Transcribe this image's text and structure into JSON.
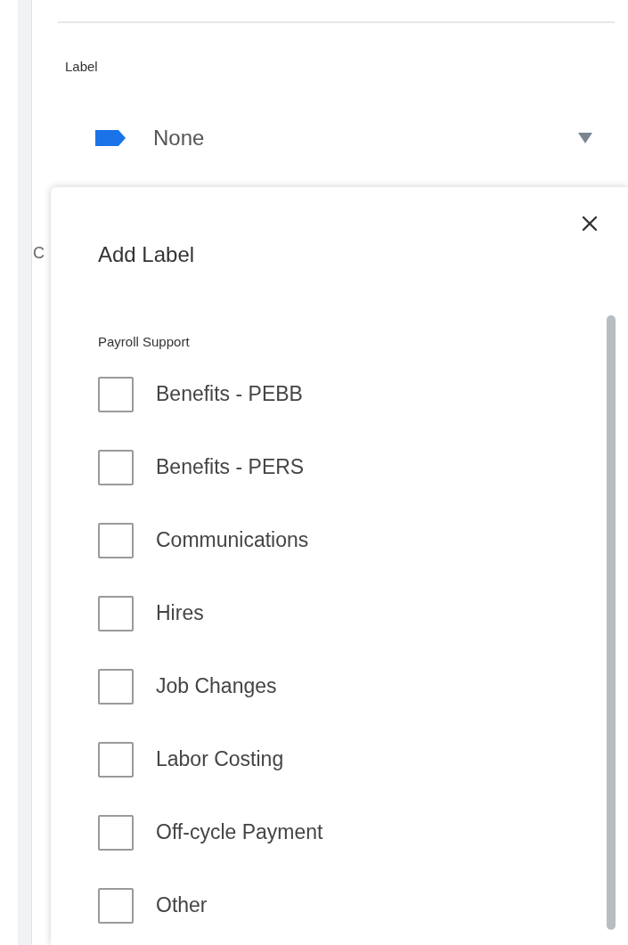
{
  "field": {
    "label": "Label",
    "value": "None"
  },
  "covered_text": "C",
  "popup": {
    "title": "Add Label",
    "group": "Payroll Support",
    "options": [
      {
        "label": "Benefits - PEBB",
        "checked": false
      },
      {
        "label": "Benefits - PERS",
        "checked": false
      },
      {
        "label": "Communications",
        "checked": false
      },
      {
        "label": "Hires",
        "checked": false
      },
      {
        "label": "Job Changes",
        "checked": false
      },
      {
        "label": "Labor Costing",
        "checked": false
      },
      {
        "label": "Off-cycle Payment",
        "checked": false
      },
      {
        "label": "Other",
        "checked": false
      }
    ]
  }
}
